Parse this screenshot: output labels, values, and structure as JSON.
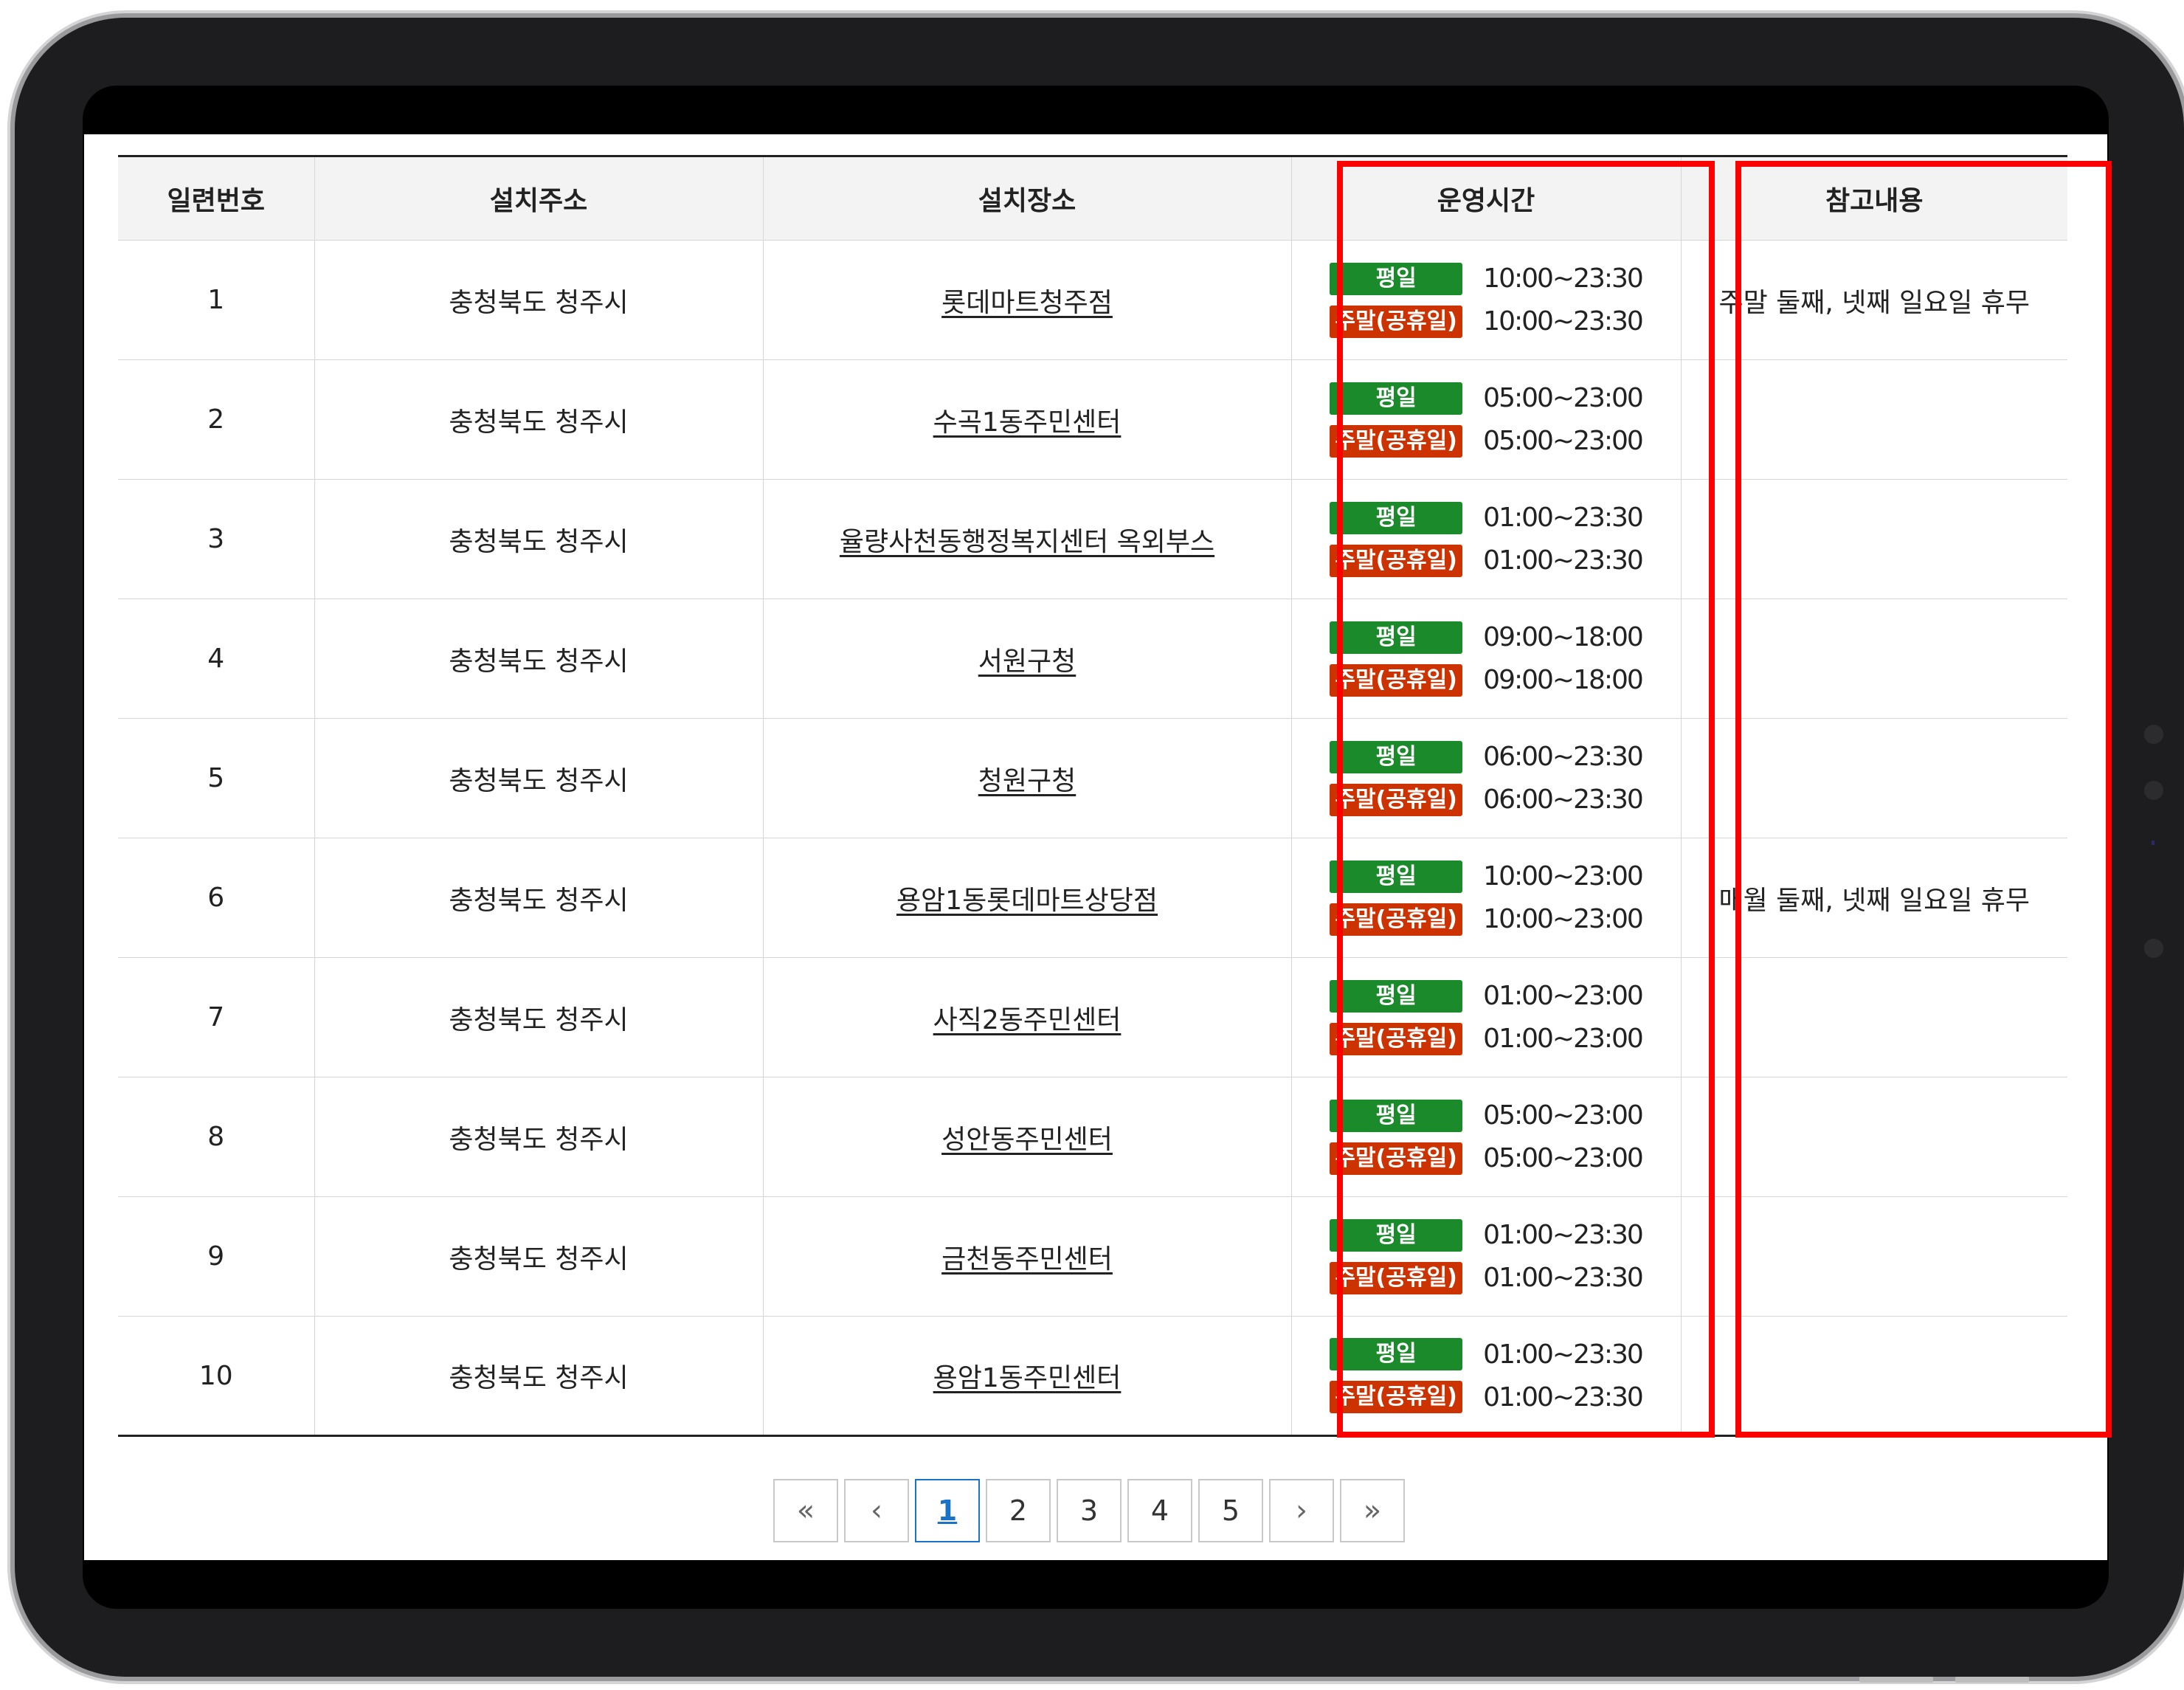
{
  "table": {
    "headers": [
      "일련번호",
      "설치주소",
      "설치장소",
      "운영시간",
      "참고내용"
    ],
    "rows": [
      {
        "no": "1",
        "address": "충청북도 청주시",
        "place": "롯데마트청주점",
        "weekday_hours": "10:00~23:30",
        "weekend_hours": "10:00~23:30",
        "note": "주말 둘째, 넷째 일요일 휴무"
      },
      {
        "no": "2",
        "address": "충청북도 청주시",
        "place": "수곡1동주민센터",
        "weekday_hours": "05:00~23:00",
        "weekend_hours": "05:00~23:00",
        "note": ""
      },
      {
        "no": "3",
        "address": "충청북도 청주시",
        "place": "율량사천동행정복지센터 옥외부스",
        "weekday_hours": "01:00~23:30",
        "weekend_hours": "01:00~23:30",
        "note": ""
      },
      {
        "no": "4",
        "address": "충청북도 청주시",
        "place": "서원구청",
        "weekday_hours": "09:00~18:00",
        "weekend_hours": "09:00~18:00",
        "note": ""
      },
      {
        "no": "5",
        "address": "충청북도 청주시",
        "place": "청원구청",
        "weekday_hours": "06:00~23:30",
        "weekend_hours": "06:00~23:30",
        "note": ""
      },
      {
        "no": "6",
        "address": "충청북도 청주시",
        "place": "용암1동롯데마트상당점",
        "weekday_hours": "10:00~23:00",
        "weekend_hours": "10:00~23:00",
        "note": "매월 둘째, 넷째 일요일 휴무"
      },
      {
        "no": "7",
        "address": "충청북도 청주시",
        "place": "사직2동주민센터",
        "weekday_hours": "01:00~23:00",
        "weekend_hours": "01:00~23:00",
        "note": ""
      },
      {
        "no": "8",
        "address": "충청북도 청주시",
        "place": "성안동주민센터",
        "weekday_hours": "05:00~23:00",
        "weekend_hours": "05:00~23:00",
        "note": ""
      },
      {
        "no": "9",
        "address": "충청북도 청주시",
        "place": "금천동주민센터",
        "weekday_hours": "01:00~23:30",
        "weekend_hours": "01:00~23:30",
        "note": ""
      },
      {
        "no": "10",
        "address": "충청북도 청주시",
        "place": "용암1동주민센터",
        "weekday_hours": "01:00~23:30",
        "weekend_hours": "01:00~23:30",
        "note": ""
      }
    ],
    "badges": {
      "weekday": "평일",
      "weekend": "주말(공휴일)"
    }
  },
  "pagination": {
    "first_icon": "double-chevron-left-icon",
    "prev_icon": "chevron-left-icon",
    "pages": [
      "1",
      "2",
      "3",
      "4",
      "5"
    ],
    "current": "1",
    "next_icon": "chevron-right-icon",
    "last_icon": "double-chevron-right-icon"
  },
  "colors": {
    "weekday_badge": "#1a8a2a",
    "weekend_badge": "#cc3300",
    "highlight": "#ff0000",
    "active_page": "#1a73c6"
  }
}
